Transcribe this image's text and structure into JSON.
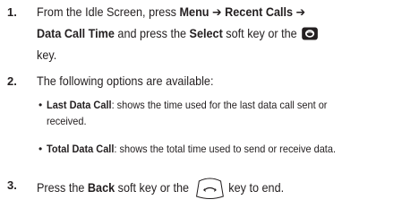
{
  "steps": [
    {
      "number": "1.",
      "line1": {
        "t1": "From the Idle Screen, press ",
        "b1": "Menu",
        "arrow1": " ➔ ",
        "b2": "Recent Calls",
        "arrow2": " ➔"
      },
      "line2": {
        "b1": "Data Call Time",
        "t1": " and press the ",
        "b2": "Select",
        "t2": " soft key or the ",
        "icon": "ok-key-icon"
      },
      "line3": {
        "t1": "key."
      }
    },
    {
      "number": "2.",
      "line1": {
        "t1": "The following options are available:"
      },
      "bullets": [
        {
          "name": "Last Data Call",
          "colon": ":",
          "desc_line1": " shows the time used for the last data call sent or",
          "desc_line2": "received."
        },
        {
          "name": "Total Data Call",
          "colon": ":",
          "desc_line1": " shows the total time used to send or receive data."
        }
      ]
    },
    {
      "number": "3.",
      "line1": {
        "t1": "Press the ",
        "b1": "Back",
        "t2": " soft key or the ",
        "icon": "end-key-icon",
        "t3": " key to end."
      }
    }
  ],
  "colors": {
    "text": "#231f20",
    "ok_key_fill": "#231f20"
  }
}
